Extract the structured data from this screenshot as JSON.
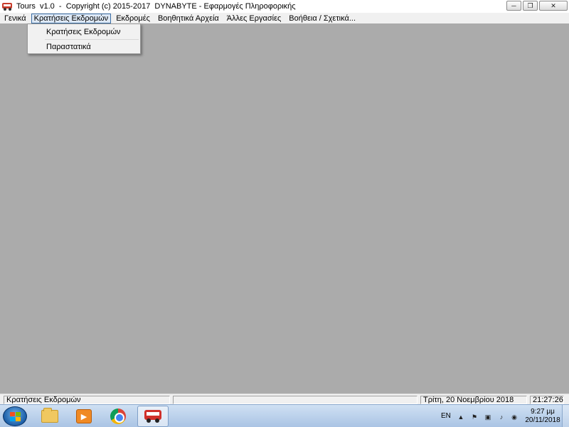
{
  "window": {
    "title": "Tours  v1.0  -  Copyright (c) 2015-2017  DYNABYTE - Εφαρμογές Πληροφορικής",
    "minimize_symbol": "─",
    "maximize_symbol": "❐",
    "close_symbol": "✕"
  },
  "menubar": {
    "items": [
      {
        "label": "Γενικά"
      },
      {
        "label": "Κρατήσεις Εκδρομών"
      },
      {
        "label": "Εκδρομές"
      },
      {
        "label": "Βοηθητικά Αρχεία"
      },
      {
        "label": "Άλλες Εργασίες"
      },
      {
        "label": "Βοήθεια / Σχετικά..."
      }
    ]
  },
  "dropdown": {
    "items": [
      {
        "label": "Κρατήσεις Εκδρομών"
      },
      {
        "label": "Παραστατικά"
      }
    ]
  },
  "statusbar": {
    "left_text": "Κρατήσεις Εκδρομών",
    "middle_text": "",
    "date_text": "Τρίτη, 20 Νοεμβρίου 2018",
    "time_text": "21:27:26"
  },
  "taskbar": {
    "language": "EN",
    "clock_time": "9:27 μμ",
    "clock_date": "20/11/2018",
    "pinned_icons": [
      "file-explorer-icon",
      "media-player-icon",
      "chrome-icon",
      "tours-bus-icon"
    ]
  },
  "colors": {
    "workspace": "#ababab",
    "menubar": "#f0f0f0",
    "highlight_border": "#3b6ea5"
  }
}
